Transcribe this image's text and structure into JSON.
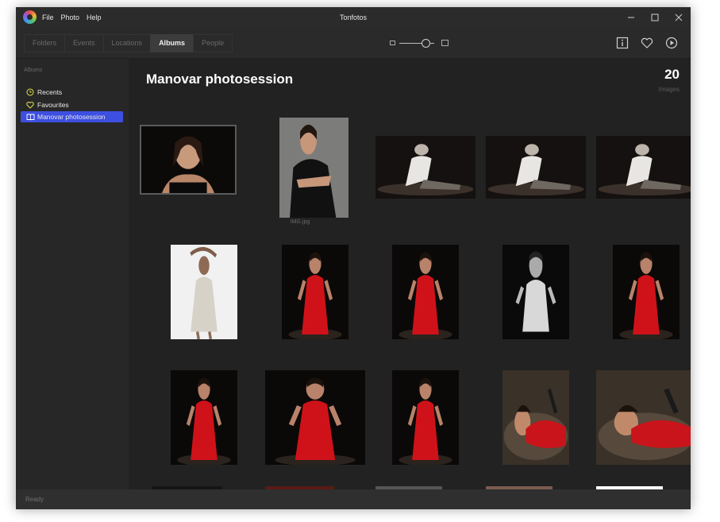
{
  "window": {
    "title": "Tonfotos",
    "menu": [
      "File",
      "Photo",
      "Help"
    ]
  },
  "toolbar": {
    "tabs": [
      "Folders",
      "Events",
      "Locations",
      "Albums",
      "People"
    ],
    "active_tab": "Albums",
    "zoom_level": 0.75
  },
  "sidebar": {
    "heading": "Albums",
    "items": [
      {
        "label": "Recents",
        "icon": "clock-icon",
        "color": "#d4d44a"
      },
      {
        "label": "Favourites",
        "icon": "heart-icon",
        "color": "#d4d44a"
      },
      {
        "label": "Manovar photosession",
        "icon": "album-book-icon",
        "selected": true
      }
    ]
  },
  "main": {
    "album_title": "Manovar photosession",
    "image_count": "20",
    "image_count_label": "Images",
    "hover_caption": "IMG.jpg"
  },
  "status": {
    "text": "Ready"
  },
  "colors": {
    "accent": "#3d4fe0",
    "background": "#222222",
    "sidebar": "#272727"
  },
  "photos": [
    {
      "kind": "portrait-black-top"
    },
    {
      "kind": "woman-black-dress-gray-bg"
    },
    {
      "kind": "bw-man-sitting"
    },
    {
      "kind": "bw-man-sitting"
    },
    {
      "kind": "bw-man-sitting"
    },
    {
      "kind": "white-dress-white-bg"
    },
    {
      "kind": "red-dress-dark"
    },
    {
      "kind": "red-dress-dark"
    },
    {
      "kind": "bw-woman-dark"
    },
    {
      "kind": "red-dress-dark"
    },
    {
      "kind": "red-dress-dark"
    },
    {
      "kind": "red-dress-dark"
    },
    {
      "kind": "red-dress-dark"
    },
    {
      "kind": "woman-lying-red"
    },
    {
      "kind": "woman-lying-red"
    }
  ]
}
